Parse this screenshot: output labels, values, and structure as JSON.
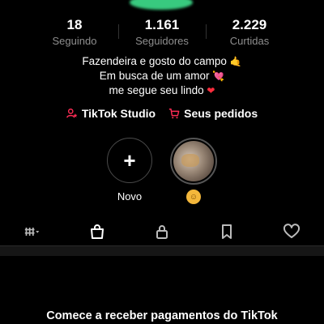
{
  "stats": [
    {
      "value": "18",
      "label": "Seguindo"
    },
    {
      "value": "1.161",
      "label": "Seguidores"
    },
    {
      "value": "2.229",
      "label": "Curtidas"
    }
  ],
  "bio": {
    "line1": "Fazendeira e gosto do campo",
    "line1_emoji": "🤙",
    "line2": "Em busca de um amor",
    "line2_emoji": "💘",
    "line3": "me segue seu lindo",
    "line3_emoji": "❤"
  },
  "links": {
    "studio_label": "TikTok Studio",
    "orders_label": "Seus pedidos"
  },
  "stories": {
    "new_label": "Novo",
    "avatar_emoji": "☺"
  },
  "tabs": [
    "videos-grid",
    "shop",
    "private",
    "saved",
    "liked"
  ],
  "promo": {
    "text": "Comece a receber pagamentos do TikTok"
  },
  "colors": {
    "accent_red": "#fe2c55",
    "muted": "#8e8e8e",
    "background": "#000000"
  }
}
